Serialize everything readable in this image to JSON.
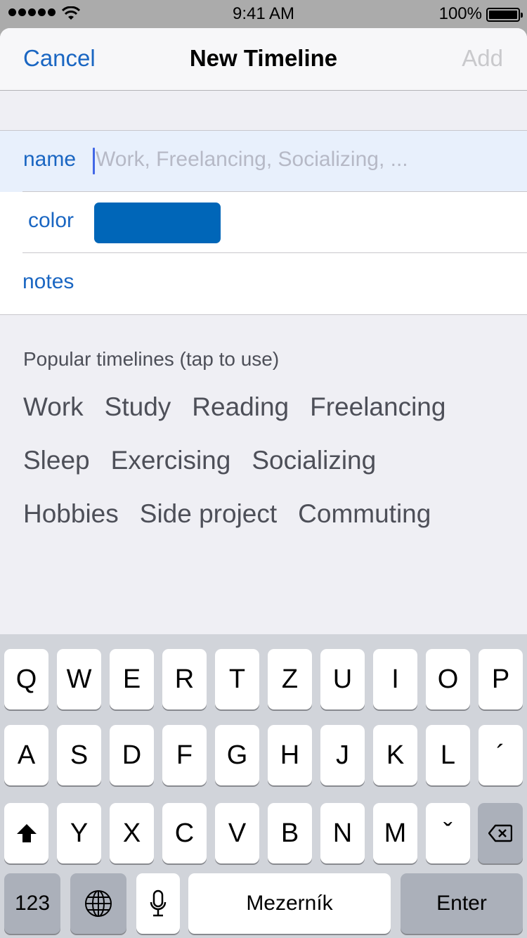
{
  "status_bar": {
    "time": "9:41 AM",
    "battery_percent": "100%",
    "signal_bars": 5,
    "battery_level": 1.0
  },
  "navbar": {
    "cancel_label": "Cancel",
    "title": "New Timeline",
    "add_label": "Add",
    "add_enabled": false
  },
  "form": {
    "name": {
      "label": "name",
      "value": "",
      "placeholder": "Work, Freelancing, Socializing, ..."
    },
    "color": {
      "label": "color",
      "value": "#0066b8"
    },
    "notes": {
      "label": "notes",
      "value": ""
    }
  },
  "popular": {
    "heading": "Popular timelines (tap to use)",
    "rows": [
      [
        "Work",
        "Study",
        "Reading",
        "Freelancing"
      ],
      [
        "Sleep",
        "Exercising",
        "Socializing"
      ],
      [
        "Hobbies",
        "Side project",
        "Commuting"
      ]
    ]
  },
  "keyboard": {
    "row1": [
      "Q",
      "W",
      "E",
      "R",
      "T",
      "Z",
      "U",
      "I",
      "O",
      "P"
    ],
    "row2": [
      "A",
      "S",
      "D",
      "F",
      "G",
      "H",
      "J",
      "K",
      "L",
      "´"
    ],
    "row3": [
      "Y",
      "X",
      "C",
      "V",
      "B",
      "N",
      "M",
      "ˇ"
    ],
    "numbers_label": "123",
    "space_label": "Mezerník",
    "enter_label": "Enter",
    "shift_icon": "shift-icon",
    "globe_icon": "globe-icon",
    "mic_icon": "microphone-icon",
    "delete_icon": "delete-icon"
  },
  "colors": {
    "accent": "#1a66c2",
    "swatch": "#0066b8",
    "active_row": "#e8f0fc"
  }
}
